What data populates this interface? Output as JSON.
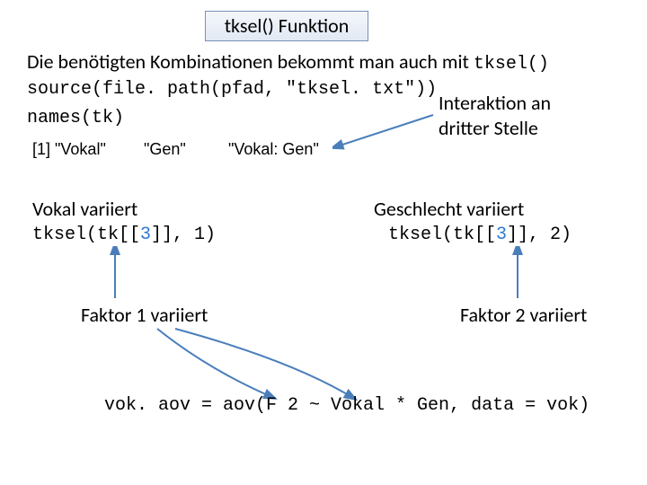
{
  "title": "tksel() Funktion",
  "line1a": "Die benötigten Kombinationen bekommt man auch mit ",
  "line1b": "tksel()",
  "line2": "source(file. path(pfad, \"tksel. txt\"))",
  "line3": "names(tk)",
  "interaction_l1": "Interaktion an",
  "interaction_l2": "dritter Stelle",
  "out_prefix": "[1] ",
  "out_v1": "\"Vokal\"",
  "out_v2": "\"Gen\"",
  "out_v3": "\"Vokal: Gen\"",
  "vokal_var": "Vokal variiert",
  "gesch_var": "Geschlecht variiert",
  "call1_pre": "tksel(tk[[",
  "call1_num": "3",
  "call1_post": "]], 1)",
  "call2_pre": "tksel(tk[[",
  "call2_num": "3",
  "call2_post": "]], 2)",
  "faktor1": "Faktor 1 variiert",
  "faktor2": "Faktor 2 variiert",
  "final_code": "vok. aov = aov(F 2 ~ Vokal * Gen, data = vok)"
}
